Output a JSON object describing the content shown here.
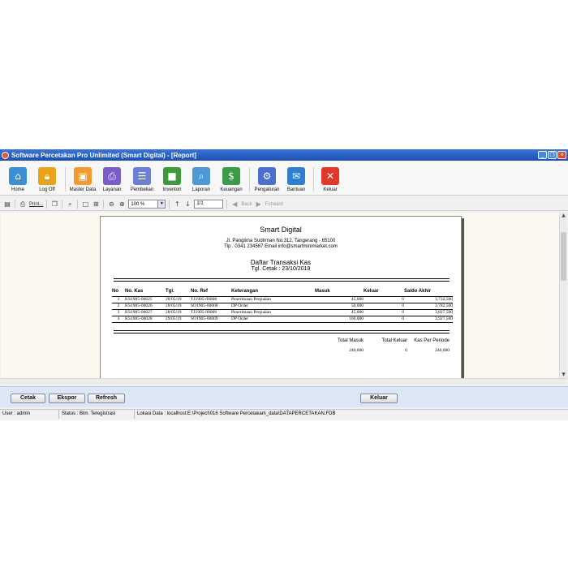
{
  "window": {
    "title": "Software Percetakan Pro Unlimited (Smart Digital) - [Report]"
  },
  "toolbar": {
    "items": [
      {
        "label": "Home",
        "icon": "store-icon",
        "color": "#3a8fd6"
      },
      {
        "label": "Log Off",
        "icon": "lock-icon",
        "color": "#e8a317"
      },
      {
        "label": "Master Data",
        "icon": "box-icon",
        "color": "#f29a2e"
      },
      {
        "label": "Layanan",
        "icon": "printer-icon",
        "color": "#7b5cc9"
      },
      {
        "label": "Pembelian",
        "icon": "list-icon",
        "color": "#6b7fd6"
      },
      {
        "label": "Inventori",
        "icon": "package-icon",
        "color": "#3d9a3d"
      },
      {
        "label": "Laporan",
        "icon": "report-search-icon",
        "color": "#4b9ad6"
      },
      {
        "label": "Keuangan",
        "icon": "money-icon",
        "color": "#3c9a4b"
      },
      {
        "label": "Pengaturan",
        "icon": "gears-icon",
        "color": "#4a6fd0"
      },
      {
        "label": "Bantuan",
        "icon": "chat-icon",
        "color": "#2f7fd0"
      },
      {
        "label": "Keluar",
        "icon": "exit-icon",
        "color": "#e0392b"
      }
    ]
  },
  "viewer": {
    "print_label": "Print...",
    "zoom": "100 %",
    "page": "1/1",
    "back_label": "Back",
    "forward_label": "Forward"
  },
  "report": {
    "company": "Smart Digital",
    "address": "Jl. Panglima Sudirman No.312, Tangerang - 65100",
    "contact": "Tlp : 0341 234567 Email info@smartminimarket.com",
    "title": "Daftar Transaksi Kas",
    "print_date": "Tgl. Cetak : 23/10/2019",
    "columns": [
      "No",
      "No. Kas",
      "Tgl.",
      "No. Ref",
      "Keterangan",
      "Masuk",
      "Keluar",
      "Saldo Akhir"
    ],
    "rows": [
      [
        "1",
        "KS1905-00025",
        "28/05/19",
        "TJ1905-00008",
        "Penerimaan Penjualan",
        "45,000",
        "0",
        "3,732,500"
      ],
      [
        "2",
        "KS1905-00026",
        "28/05/19",
        "SO1905-00008",
        "DP Order",
        "50,000",
        "0",
        "3,782,500"
      ],
      [
        "3",
        "KS1905-00027",
        "28/05/19",
        "TJ1905-00009",
        "Penerimaan Penjualan",
        "45,000",
        "0",
        "3,827,500"
      ],
      [
        "4",
        "KS1905-00028",
        "29/05/19",
        "SO1905-00009",
        "DP Order",
        "100,000",
        "0",
        "3,927,500"
      ]
    ],
    "totals": {
      "masuk_label": "Total Masuk",
      "masuk": "240,000",
      "keluar_label": "Total Keluar",
      "keluar": "0",
      "periode_label": "Kas Per Periode",
      "periode": "240,000"
    }
  },
  "buttons": {
    "cetak": "Cetak",
    "ekspor": "Ekspor",
    "refresh": "Refresh",
    "keluar": "Keluar"
  },
  "status": {
    "user": "User : admin",
    "reg": "Status : Blm. Teregistrasi",
    "db": "Lokasi Data : localhost:E:\\Project\\016 Software Percetakan\\_data\\DATAPERCETAKAN.FDB"
  }
}
